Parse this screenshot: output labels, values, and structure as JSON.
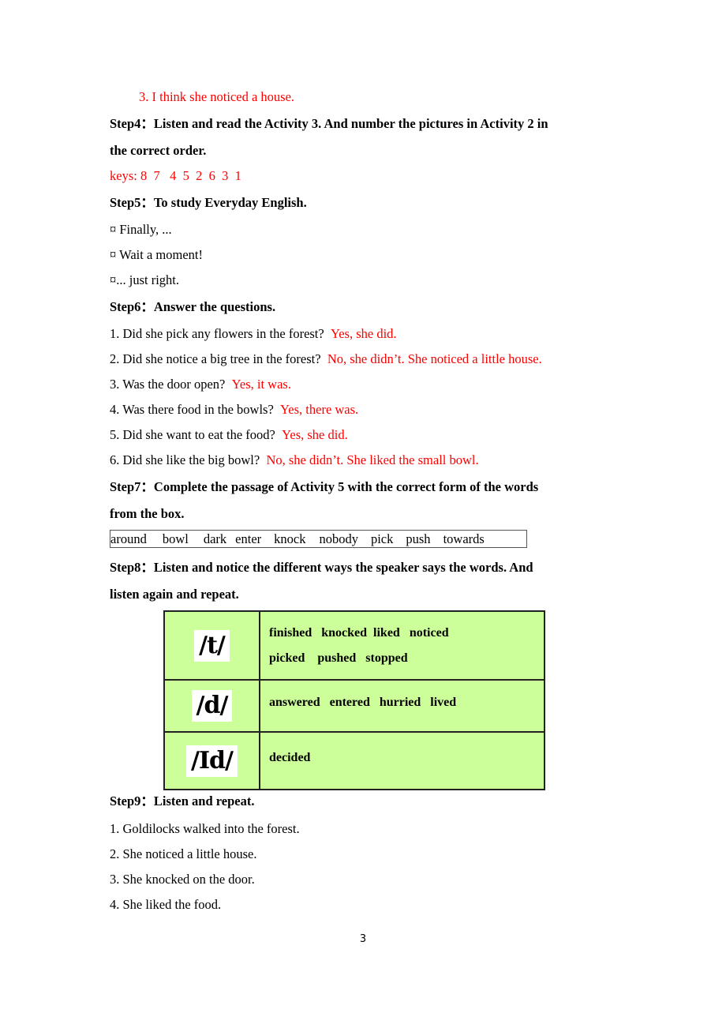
{
  "top_answer": "3. I think she noticed a house.",
  "step4": {
    "heading_line1": "Step4：Listen and read the Activity 3. And number the pictures in Activity 2 in",
    "heading_line2": "the correct order.",
    "keys": "keys: 8  7   4  5  2  6  3  1"
  },
  "step5": {
    "heading": "Step5：To study Everyday English.",
    "items": [
      "¤ Finally, ...",
      "¤ Wait a moment!",
      "¤... just right."
    ]
  },
  "step6": {
    "heading": "Step6：Answer the questions.",
    "qa": [
      {
        "q": "1. Did she pick any flowers in the forest?",
        "a": "Yes, she did."
      },
      {
        "q": "2. Did she notice a big tree in the forest?",
        "a": "No, she didn’t. She noticed a little house."
      },
      {
        "q": "3. Was the door open?",
        "a": "Yes, it was."
      },
      {
        "q": "4. Was there food in the bowls?",
        "a": "Yes, there was."
      },
      {
        "q": "5. Did she want to eat the food?",
        "a": "Yes, she did."
      },
      {
        "q": "6. Did she like the big bowl?",
        "a": "No, she didn’t. She liked the small bowl."
      }
    ]
  },
  "step7": {
    "heading_line1": "Step7：Complete the passage of Activity 5 with the correct form of the words",
    "heading_line2": "from the box.",
    "words": [
      "around",
      "bowl",
      "dark",
      "enter",
      "knock",
      "nobody",
      "pick",
      "push",
      "towards"
    ]
  },
  "step8": {
    "heading_line1": "Step8：Listen and notice the different ways the speaker says the words. And",
    "heading_line2": "listen again and repeat.",
    "rows": [
      {
        "symbol": "/t/",
        "line1": "finished   knocked  liked   noticed",
        "line2": "picked    pushed   stopped"
      },
      {
        "symbol": "/d/",
        "line1": "answered   entered   hurried   lived",
        "line2": ""
      },
      {
        "symbol": "/Id/",
        "line1": "decided",
        "line2": ""
      }
    ],
    "table_color": "#ccff99"
  },
  "step9": {
    "heading": "Step9：Listen and repeat.",
    "items": [
      "1. Goldilocks walked into the forest.",
      "2. She noticed a little house.",
      "3. She knocked on the door.",
      "4. She liked the food."
    ]
  },
  "page_number": "3"
}
